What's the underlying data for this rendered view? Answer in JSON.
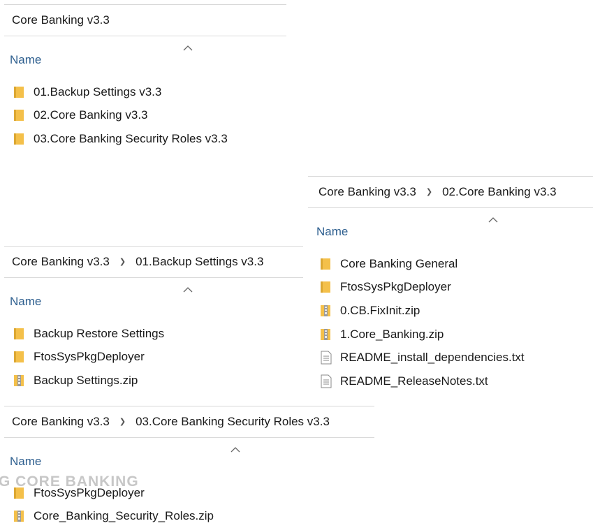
{
  "panel_root": {
    "breadcrumb": [
      "Core Banking v3.3"
    ],
    "column_header": "Name",
    "items": [
      {
        "name": "01.Backup Settings v3.3",
        "icon": "folder-icon"
      },
      {
        "name": "02.Core Banking v3.3",
        "icon": "folder-icon"
      },
      {
        "name": "03.Core Banking Security Roles v3.3",
        "icon": "folder-icon"
      }
    ]
  },
  "panel_core": {
    "breadcrumb": [
      "Core Banking v3.3",
      "02.Core Banking v3.3"
    ],
    "column_header": "Name",
    "items": [
      {
        "name": "Core Banking General",
        "icon": "folder-icon"
      },
      {
        "name": "FtosSysPkgDeployer",
        "icon": "folder-icon"
      },
      {
        "name": "0.CB.FixInit.zip",
        "icon": "zip-folder-icon"
      },
      {
        "name": "1.Core_Banking.zip",
        "icon": "zip-folder-icon"
      },
      {
        "name": "README_install_dependencies.txt",
        "icon": "text-file-icon"
      },
      {
        "name": "README_ReleaseNotes.txt",
        "icon": "text-file-icon"
      }
    ]
  },
  "panel_backup": {
    "breadcrumb": [
      "Core Banking v3.3",
      "01.Backup Settings v3.3"
    ],
    "column_header": "Name",
    "items": [
      {
        "name": "Backup Restore Settings",
        "icon": "folder-icon"
      },
      {
        "name": "FtosSysPkgDeployer",
        "icon": "folder-icon"
      },
      {
        "name": "Backup Settings.zip",
        "icon": "zip-folder-icon"
      }
    ]
  },
  "panel_security": {
    "breadcrumb": [
      "Core Banking v3.3",
      "03.Core Banking Security Roles v3.3"
    ],
    "column_header": "Name",
    "items": [
      {
        "name": "FtosSysPkgDeployer",
        "icon": "folder-icon"
      },
      {
        "name": "Core_Banking_Security_Roles.zip",
        "icon": "zip-folder-icon"
      }
    ]
  },
  "watermark": "G CORE BANKING",
  "colors": {
    "folder": "#f4c04a",
    "folder_dark": "#dca732",
    "header_text": "#2e5f8f",
    "divider": "#d9d9d9",
    "zip_band": "#9a9a9a",
    "text_file": "#8a8a8a"
  }
}
